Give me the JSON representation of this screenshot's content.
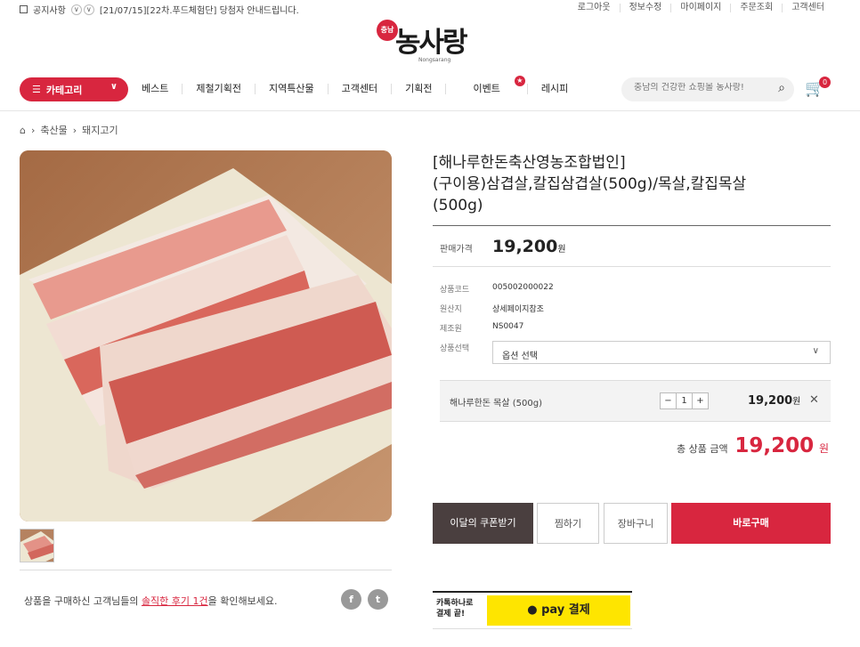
{
  "topbar": {
    "notice_label": "공지사항",
    "notice_text": "[21/07/15][22차.푸드체험단] 당첨자 안내드립니다.",
    "links": [
      "로그아웃",
      "정보수정",
      "마이페이지",
      "주문조회",
      "고객센터"
    ]
  },
  "logo": {
    "badge": "충남",
    "word": "농사랑",
    "sub": "Nongsarang"
  },
  "nav": {
    "category_label": "카테고리",
    "items": [
      "베스트",
      "제철기획전",
      "지역특산물",
      "고객센터",
      "기획전",
      "이벤트",
      "레시피"
    ],
    "search_placeholder": "충남의 건강한 쇼핑몰 농사랑!",
    "cart_count": "0"
  },
  "breadcrumb": [
    "축산물",
    "돼지고기"
  ],
  "product": {
    "title_line1": "[해나루한돈축산영농조합법인]",
    "title_line2": "(구이용)삼겹살,칼집삼겹살(500g)/목살,칼집목살",
    "title_line3": "(500g)",
    "price_label": "판매가격",
    "price": "19,200",
    "won": "원",
    "specs": [
      {
        "k": "상품코드",
        "v": "005002000022"
      },
      {
        "k": "원산지",
        "v": "상세페이지참조"
      },
      {
        "k": "제조원",
        "v": "NS0047"
      },
      {
        "k": "상품선택",
        "v": ""
      }
    ],
    "option_placeholder": "옵션 선택",
    "selected_option": {
      "name": "해나루한돈 목살 (500g)",
      "qty": "1",
      "price": "19,200"
    },
    "total_label": "총 상품 금액",
    "total_amount": "19,200"
  },
  "buttons": {
    "coupon": "이달의 쿠폰받기",
    "wish": "찜하기",
    "cart": "장바구니",
    "buy": "바로구매"
  },
  "review": {
    "pre": "상품을 구매하신 고객님들의 ",
    "link": "솔직한 후기 1건",
    "post": "을 확인해보세요."
  },
  "kakao": {
    "line1": "카톡하나로",
    "line2": "결제 끝!",
    "pay_label": "pay 결제"
  },
  "colors": {
    "brand": "#d8263f",
    "kakao": "#fee500"
  }
}
